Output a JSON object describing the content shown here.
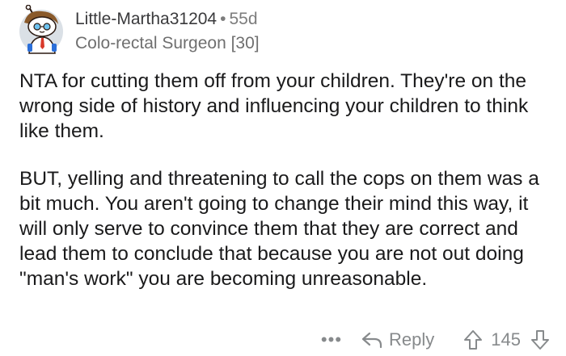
{
  "comment": {
    "username": "Little-Martha31204",
    "separator": "•",
    "age": "55d",
    "flair": "Colo-rectal Surgeon [30]",
    "paragraphs": [
      "NTA for cutting them off from your children. They're on the wrong side of history and influencing your children to think like them.",
      "BUT, yelling and threatening to call the cops on them was a bit much. You aren't going to change their mind this way, it will only serve to convince them that they are correct and lead them to conclude that because you are not out doing \"man's work\" you are becoming unreasonable."
    ],
    "actions": {
      "more_label": "•••",
      "reply_label": "Reply",
      "vote_count": "145"
    }
  },
  "icons": {
    "avatar": "snoo-avatar-icon",
    "reply": "reply-arrow-icon",
    "upvote": "upvote-arrow-icon",
    "downvote": "downvote-arrow-icon"
  },
  "colors": {
    "text": "#1a1a1b",
    "meta": "#7c7c7c",
    "action": "#878a8c",
    "avatar_bg": "#dae0e6"
  }
}
